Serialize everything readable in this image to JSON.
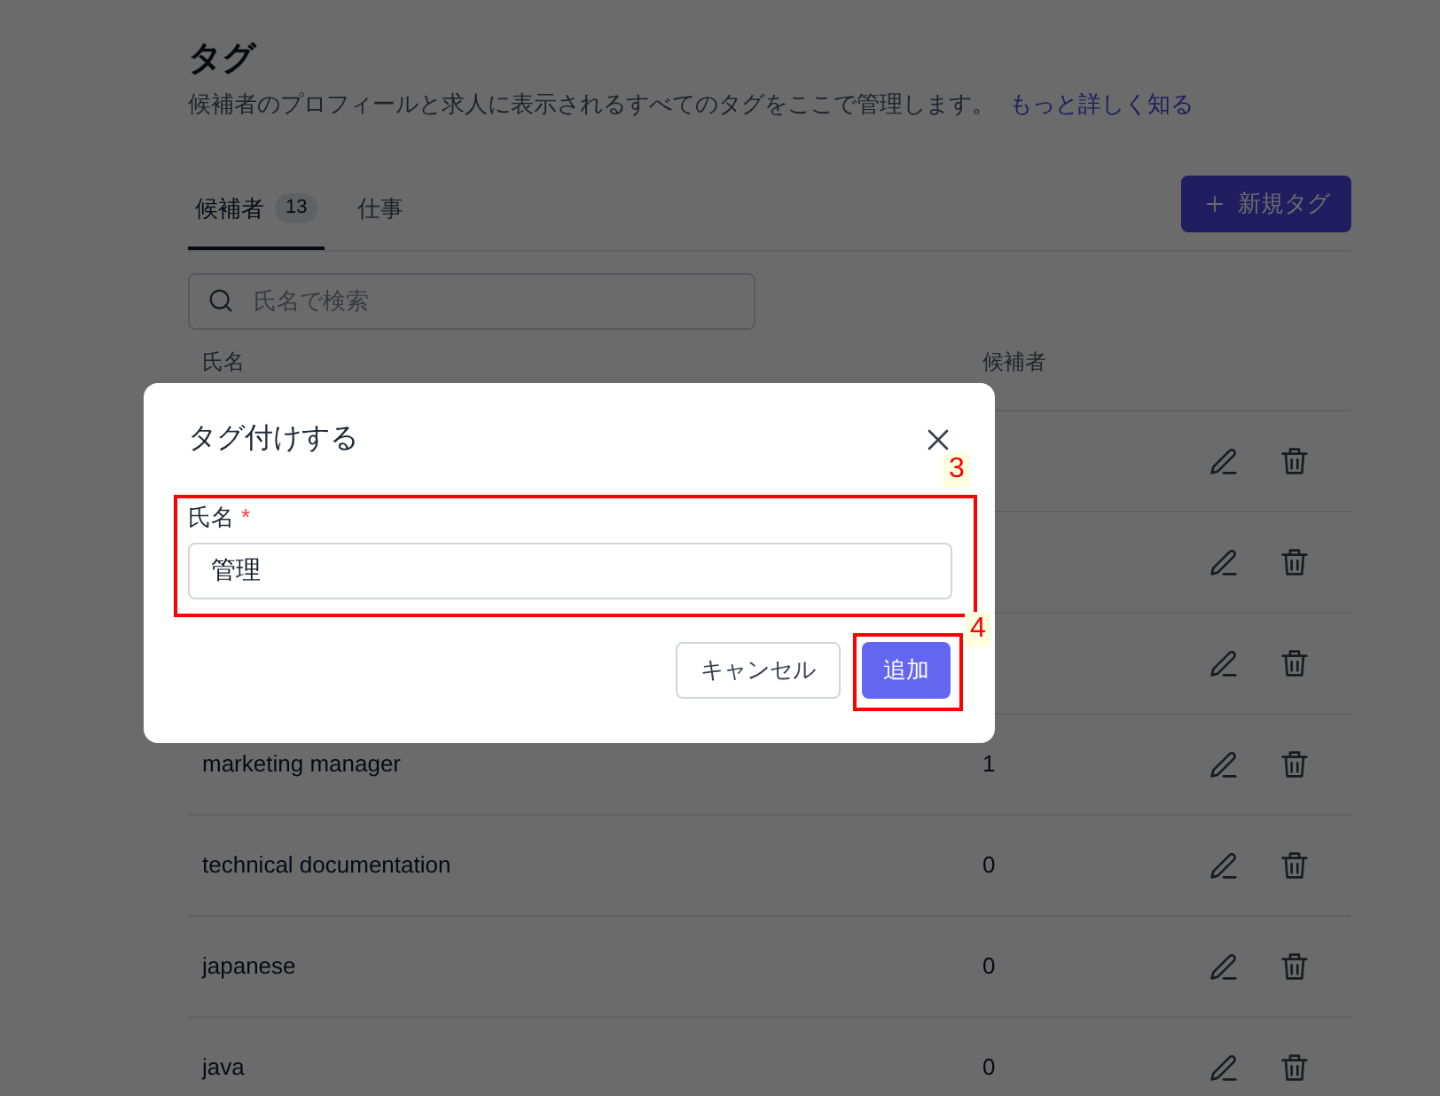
{
  "page": {
    "title": "タグ",
    "description": "候補者のプロフィールと求人に表示されるすべてのタグをここで管理します。",
    "learn_more_link": "もっと詳しく知る"
  },
  "tabs": [
    {
      "label": "候補者",
      "count": "13",
      "selected": true
    },
    {
      "label": "仕事",
      "selected": false
    }
  ],
  "new_tag_button": "新規タグ",
  "search": {
    "placeholder": "氏名で検索"
  },
  "table": {
    "columns": [
      "氏名",
      "候補者"
    ],
    "rows": [
      {},
      {},
      {},
      {
        "name": "marketing manager",
        "count": "1"
      },
      {
        "name": "technical documentation",
        "count": "0"
      },
      {
        "name": "japanese",
        "count": "0"
      },
      {
        "name": "java",
        "count": "0"
      }
    ]
  },
  "dialog": {
    "title": "タグ付けする",
    "field_label": "氏名",
    "required_mark": "*",
    "value": "管理",
    "buttons": [
      {
        "label": "キャンセル",
        "kind": "secondary"
      },
      {
        "label": "追加",
        "kind": "primary"
      }
    ]
  },
  "annotations": [
    {
      "label": "3"
    },
    {
      "label": "4"
    }
  ]
}
